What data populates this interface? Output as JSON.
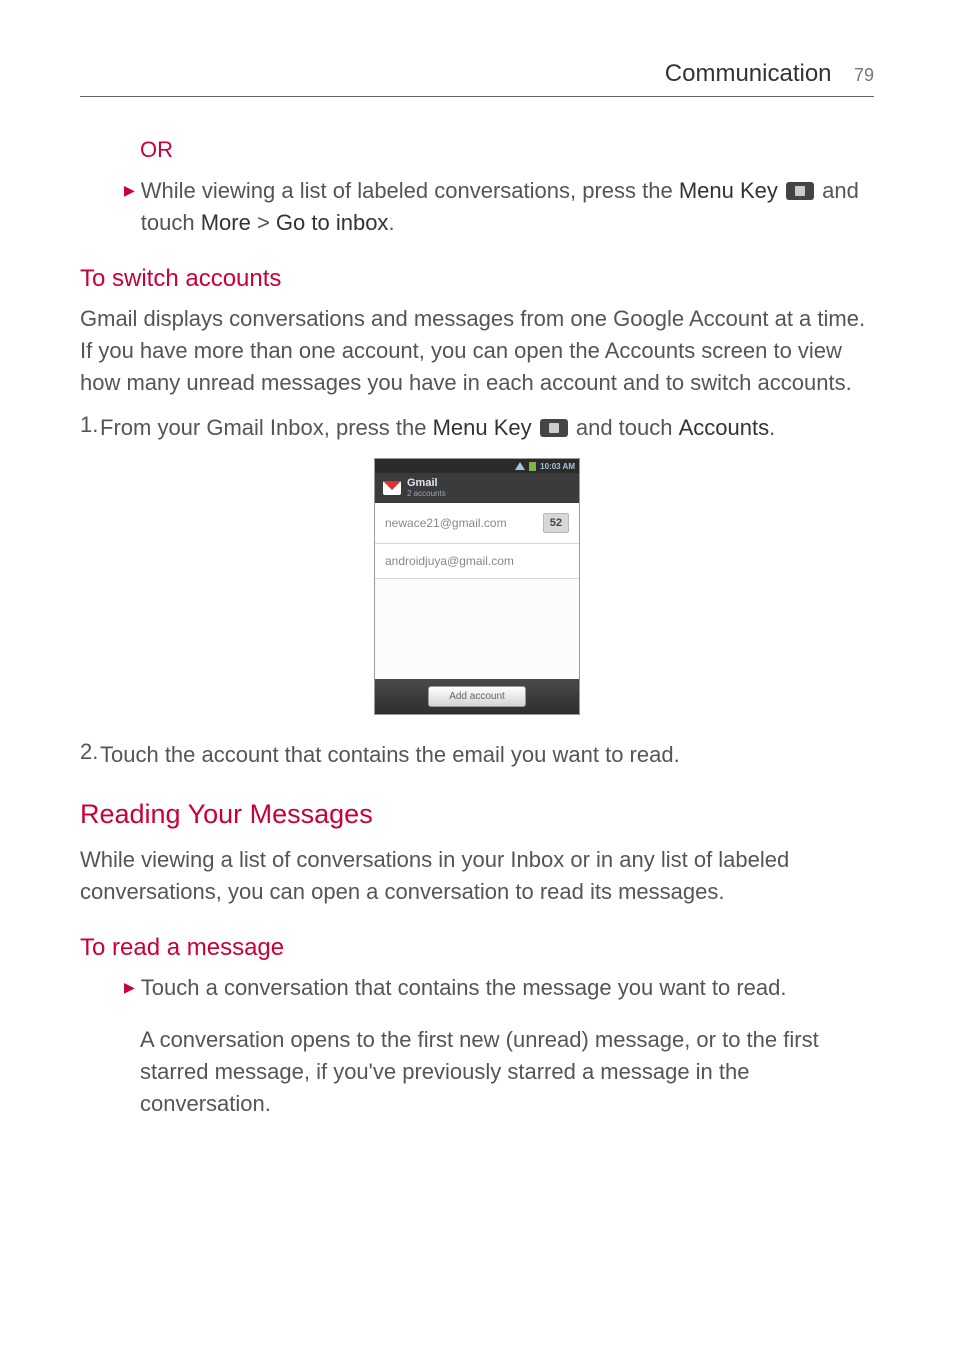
{
  "header": {
    "section": "Communication",
    "page": "79"
  },
  "or_label": "OR",
  "bullet1_part1": "While viewing a list of labeled conversations, press the ",
  "bullet1_bold1": "Menu Key",
  "bullet1_part2": " and touch ",
  "bullet1_bold2": "More",
  "bullet1_part3": " > ",
  "bullet1_bold3": "Go to inbox",
  "bullet1_part4": ".",
  "switch_accounts_heading": "To switch accounts",
  "switch_para": "Gmail displays conversations and messages from one Google Account at a time. If you have more than one account, you can open the Accounts screen to view how many unread messages you have in each account and to switch accounts.",
  "step1_num": "1.",
  "step1_p1": " From your Gmail Inbox, press the ",
  "step1_b1": "Menu Key",
  "step1_p2": " and touch ",
  "step1_b2": "Accounts",
  "step1_p3": ".",
  "screenshot": {
    "time": "10:03 AM",
    "app_title": "Gmail",
    "app_sub": "2 accounts",
    "accounts": [
      {
        "email": "newace21@gmail.com",
        "badge": "52"
      },
      {
        "email": "androidjuya@gmail.com",
        "badge": ""
      }
    ],
    "add_account": "Add account"
  },
  "step2_num": "2.",
  "step2_text": " Touch the account that contains the email you want to read.",
  "reading_heading": "Reading Your Messages",
  "reading_para": "While viewing a list of conversations in your Inbox or in any list of labeled conversations, you can open a conversation to read its messages.",
  "to_read_heading": "To read a message",
  "bullet2_text": "Touch a conversation that contains the message you want to read.",
  "conv_para": "A conversation opens to the first new (unread) message, or to the first starred message, if you've previously starred a message in the conversation."
}
